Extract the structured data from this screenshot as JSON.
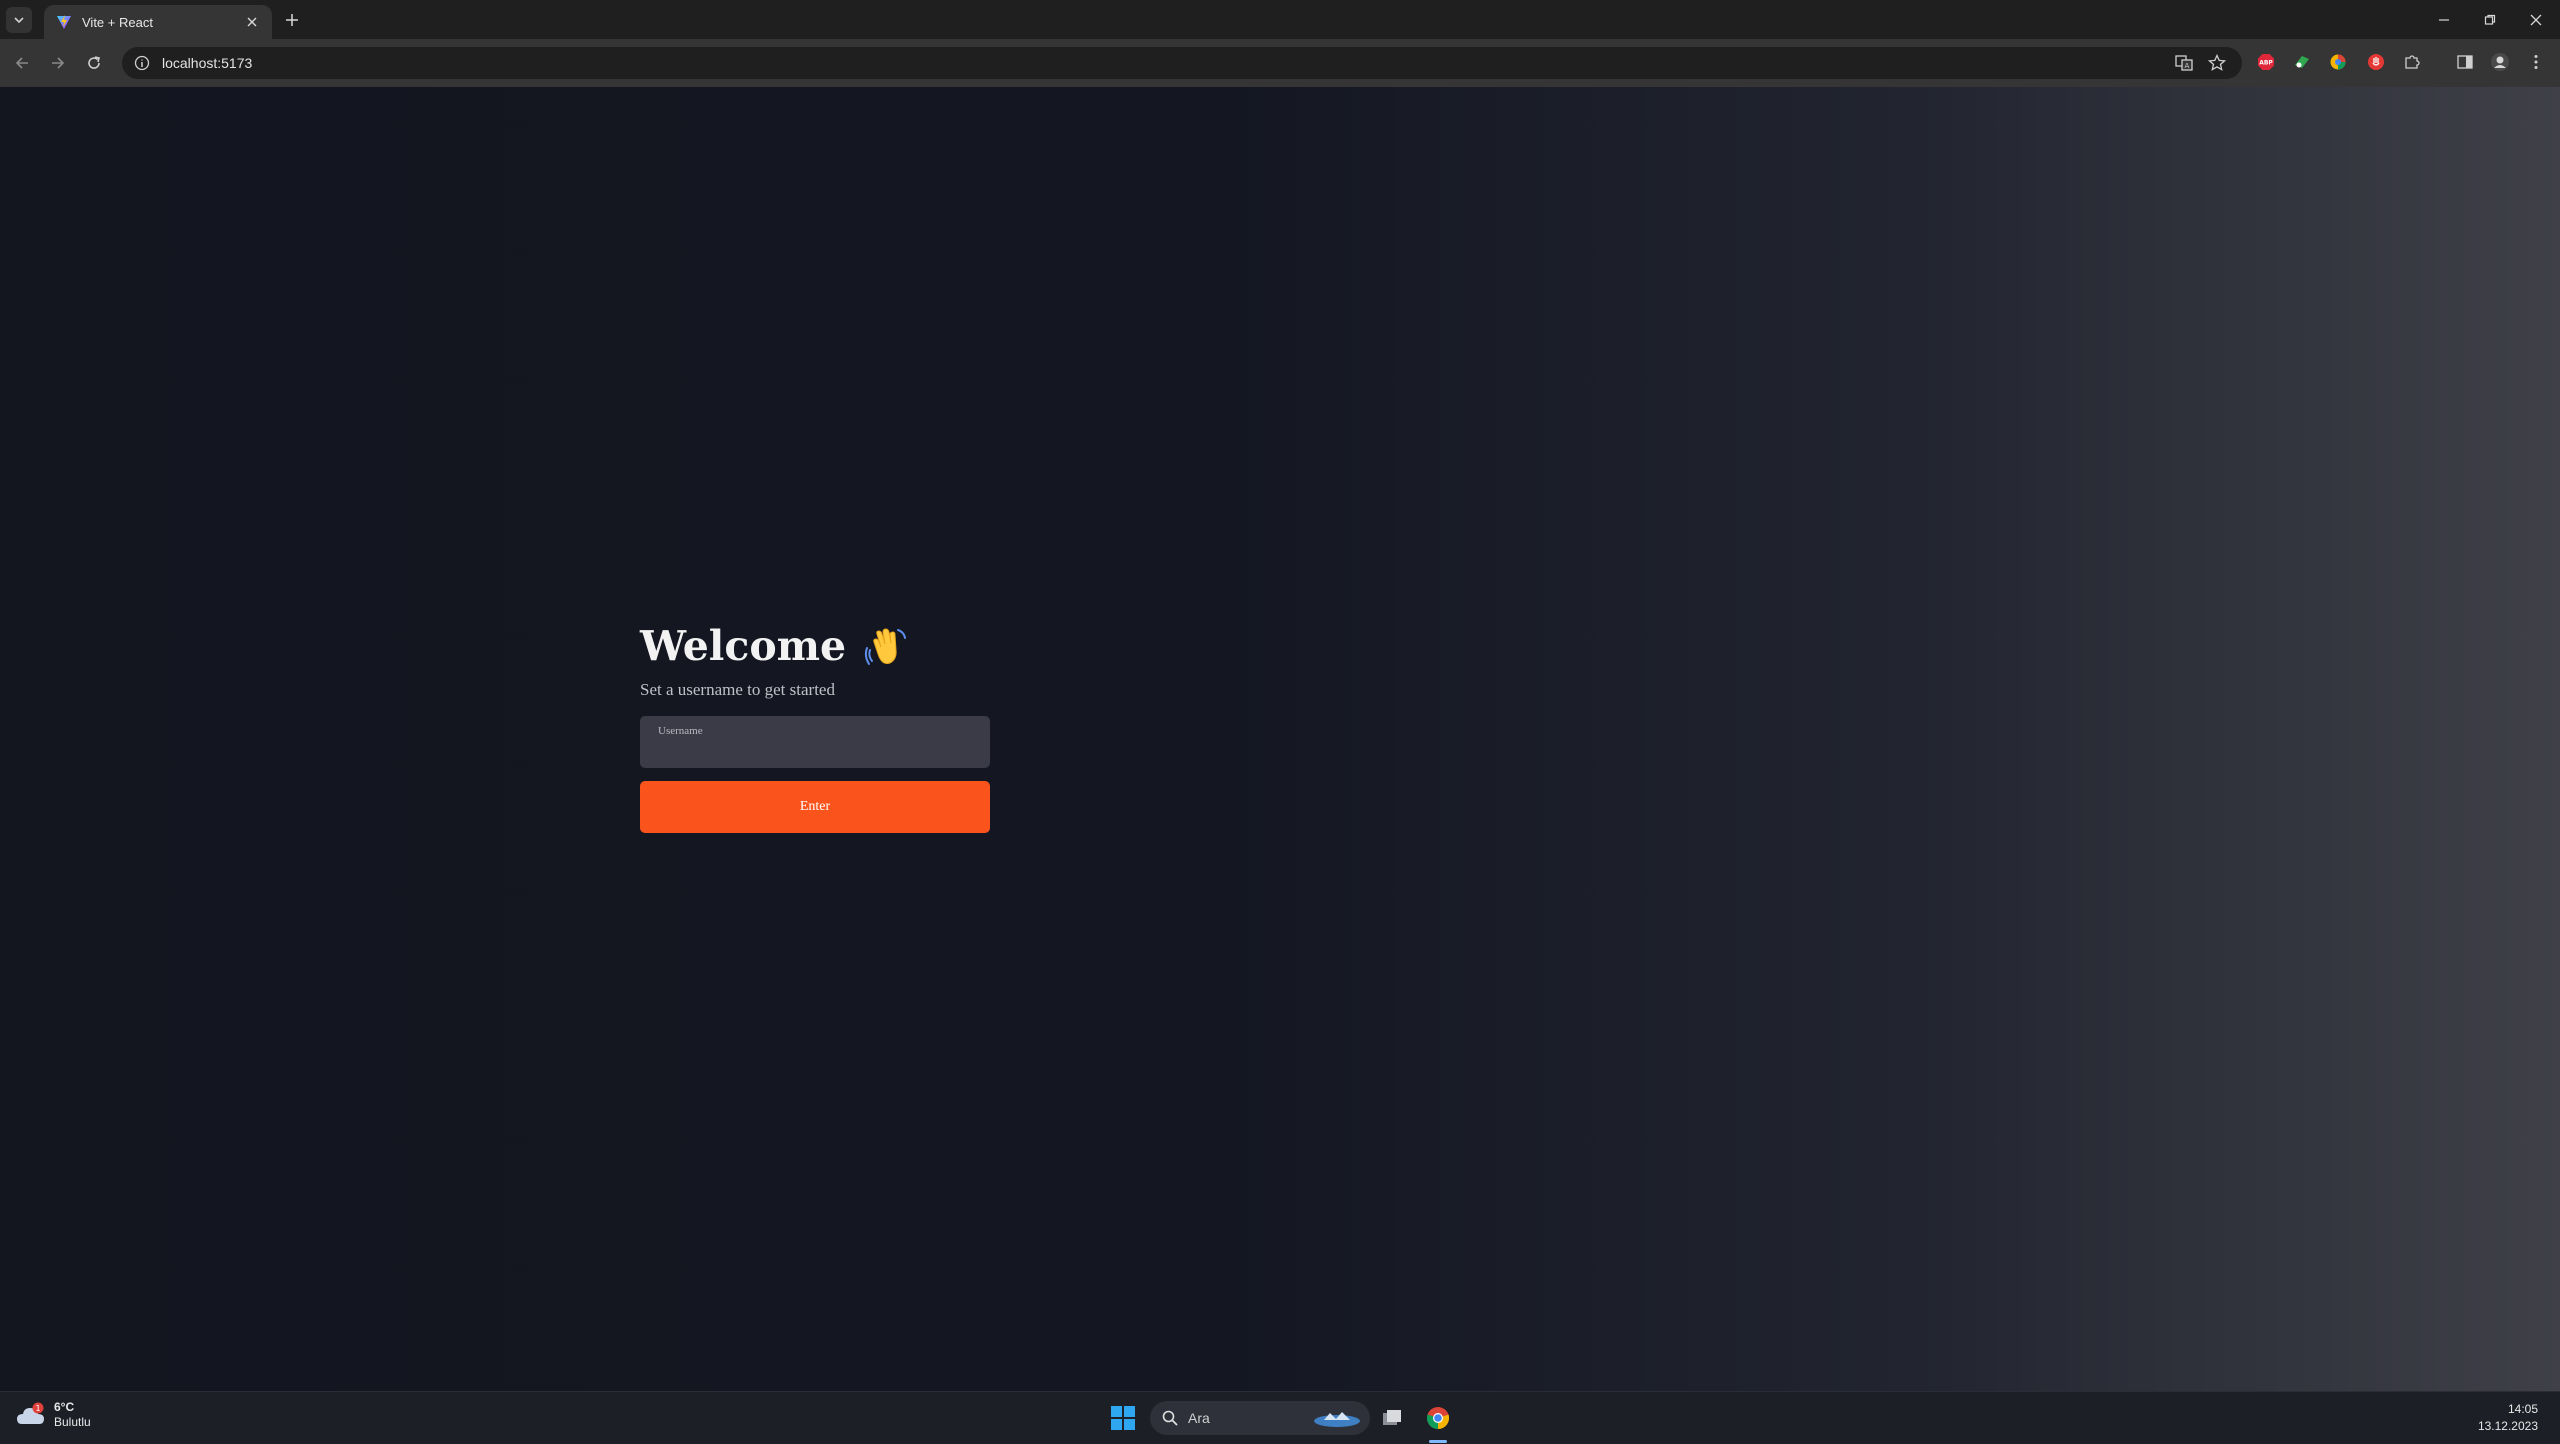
{
  "browser": {
    "tab_title": "Vite + React",
    "url": "localhost:5173",
    "icons": [
      "tab-search-icon",
      "vite-favicon",
      "close-icon",
      "new-tab-icon",
      "minimize-icon",
      "restore-icon",
      "close-window-icon",
      "back-icon",
      "forward-icon",
      "reload-icon",
      "site-info-icon",
      "translate-icon",
      "bookmark-star-icon",
      "adblock-icon",
      "extension-green-icon",
      "extension-color-icon",
      "extension-red-icon",
      "extensions-puzzle-icon",
      "side-panel-icon",
      "profile-avatar-icon",
      "menu-kebab-icon"
    ],
    "extensions": {
      "adblock_label": "ABP"
    }
  },
  "page": {
    "heading": "Welcome",
    "wave_icon": "waving-hand-icon",
    "subtitle": "Set a username to get started",
    "username_label": "Username",
    "username_value": "",
    "enter_label": "Enter",
    "accent_color": "#fa541c"
  },
  "taskbar": {
    "weather": {
      "temp": "6°C",
      "condition": "Bulutlu",
      "badge": "1",
      "icon": "cloud-weather-icon"
    },
    "search_placeholder": "Ara",
    "time": "14:05",
    "date": "13.12.2023",
    "icons": [
      "windows-start-icon",
      "search-icon",
      "task-view-icon",
      "chrome-taskbar-icon"
    ]
  }
}
